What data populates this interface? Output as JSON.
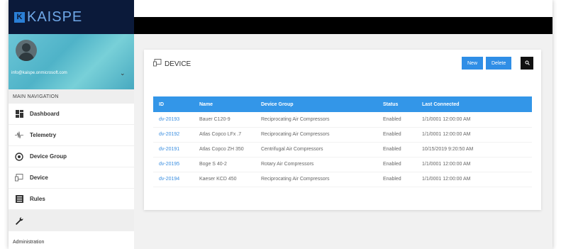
{
  "brand": {
    "name": "KAISPE",
    "logo_glyph": "K"
  },
  "profile": {
    "email": "info@kaispe.onmicrosoft.com"
  },
  "sidebar": {
    "section_title": "MAIN NAVIGATION",
    "items": [
      {
        "label": "Dashboard",
        "icon": "dashboard-icon"
      },
      {
        "label": "Telemetry",
        "icon": "telemetry-icon"
      },
      {
        "label": "Device Group",
        "icon": "device-group-icon"
      },
      {
        "label": "Device",
        "icon": "device-icon"
      },
      {
        "label": "Rules",
        "icon": "rules-icon"
      }
    ],
    "admin_icon": "wrench-icon",
    "admin_label": "Administration"
  },
  "page": {
    "title": "DEVICE",
    "buttons": {
      "new": "New",
      "delete": "Delete"
    }
  },
  "table": {
    "columns": [
      "ID",
      "Name",
      "Device Group",
      "Status",
      "Last Connected"
    ],
    "rows": [
      [
        "dv-20193",
        "Bauer C120-9",
        "Reciprocating Air Compressors",
        "Enabled",
        "1/1/0001 12:00:00 AM"
      ],
      [
        "dv-20192",
        "Atlas Copco LFx .7",
        "Reciprocating Air Compressors",
        "Enabled",
        "1/1/0001 12:00:00 AM"
      ],
      [
        "dv-20191",
        "Atlas Copco ZH 350",
        "Centrifugal Air Compressors",
        "Enabled",
        "10/15/2019 9:20:50 AM"
      ],
      [
        "dv-20195",
        "Boge S 40-2",
        "Rotary Air Compressors",
        "Enabled",
        "1/1/0001 12:00:00 AM"
      ],
      [
        "dv-20194",
        "Kaeser KCD 450",
        "Reciprocating Air Compressors",
        "Enabled",
        "1/1/0001 12:00:00 AM"
      ]
    ]
  },
  "colors": {
    "accent": "#3396e8",
    "brand_dark": "#0b1a3a",
    "link": "#3a8ee0"
  }
}
